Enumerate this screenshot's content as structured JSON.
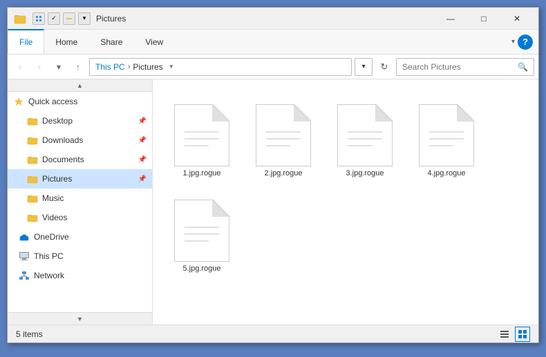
{
  "titleBar": {
    "title": "Pictures",
    "minimizeLabel": "—",
    "maximizeLabel": "□",
    "closeLabel": "✕"
  },
  "ribbon": {
    "tabs": [
      {
        "label": "File",
        "active": true
      },
      {
        "label": "Home",
        "active": false
      },
      {
        "label": "Share",
        "active": false
      },
      {
        "label": "View",
        "active": false
      }
    ],
    "helpLabel": "?"
  },
  "addressBar": {
    "backDisabled": false,
    "forwardDisabled": true,
    "pathParts": [
      "This PC",
      "Pictures"
    ],
    "searchPlaceholder": "Search Pictures",
    "refreshLabel": "⟳"
  },
  "sidebar": {
    "items": [
      {
        "label": "Quick access",
        "type": "section",
        "icon": "star"
      },
      {
        "label": "Desktop",
        "type": "item",
        "icon": "folder",
        "pinned": true
      },
      {
        "label": "Downloads",
        "type": "item",
        "icon": "folder-down",
        "pinned": true
      },
      {
        "label": "Documents",
        "type": "item",
        "icon": "folder-doc",
        "pinned": true
      },
      {
        "label": "Pictures",
        "type": "item",
        "icon": "folder-pic",
        "active": true,
        "pinned": true
      },
      {
        "label": "Music",
        "type": "item",
        "icon": "folder-music"
      },
      {
        "label": "Videos",
        "type": "item",
        "icon": "folder-vid"
      },
      {
        "label": "OneDrive",
        "type": "item",
        "icon": "cloud"
      },
      {
        "label": "This PC",
        "type": "item",
        "icon": "computer"
      },
      {
        "label": "Network",
        "type": "item",
        "icon": "network"
      }
    ]
  },
  "files": [
    {
      "name": "1.jpg.rogue"
    },
    {
      "name": "2.jpg.rogue"
    },
    {
      "name": "3.jpg.rogue"
    },
    {
      "name": "4.jpg.rogue"
    },
    {
      "name": "5.jpg.rogue"
    }
  ],
  "statusBar": {
    "itemCount": "5 items"
  }
}
